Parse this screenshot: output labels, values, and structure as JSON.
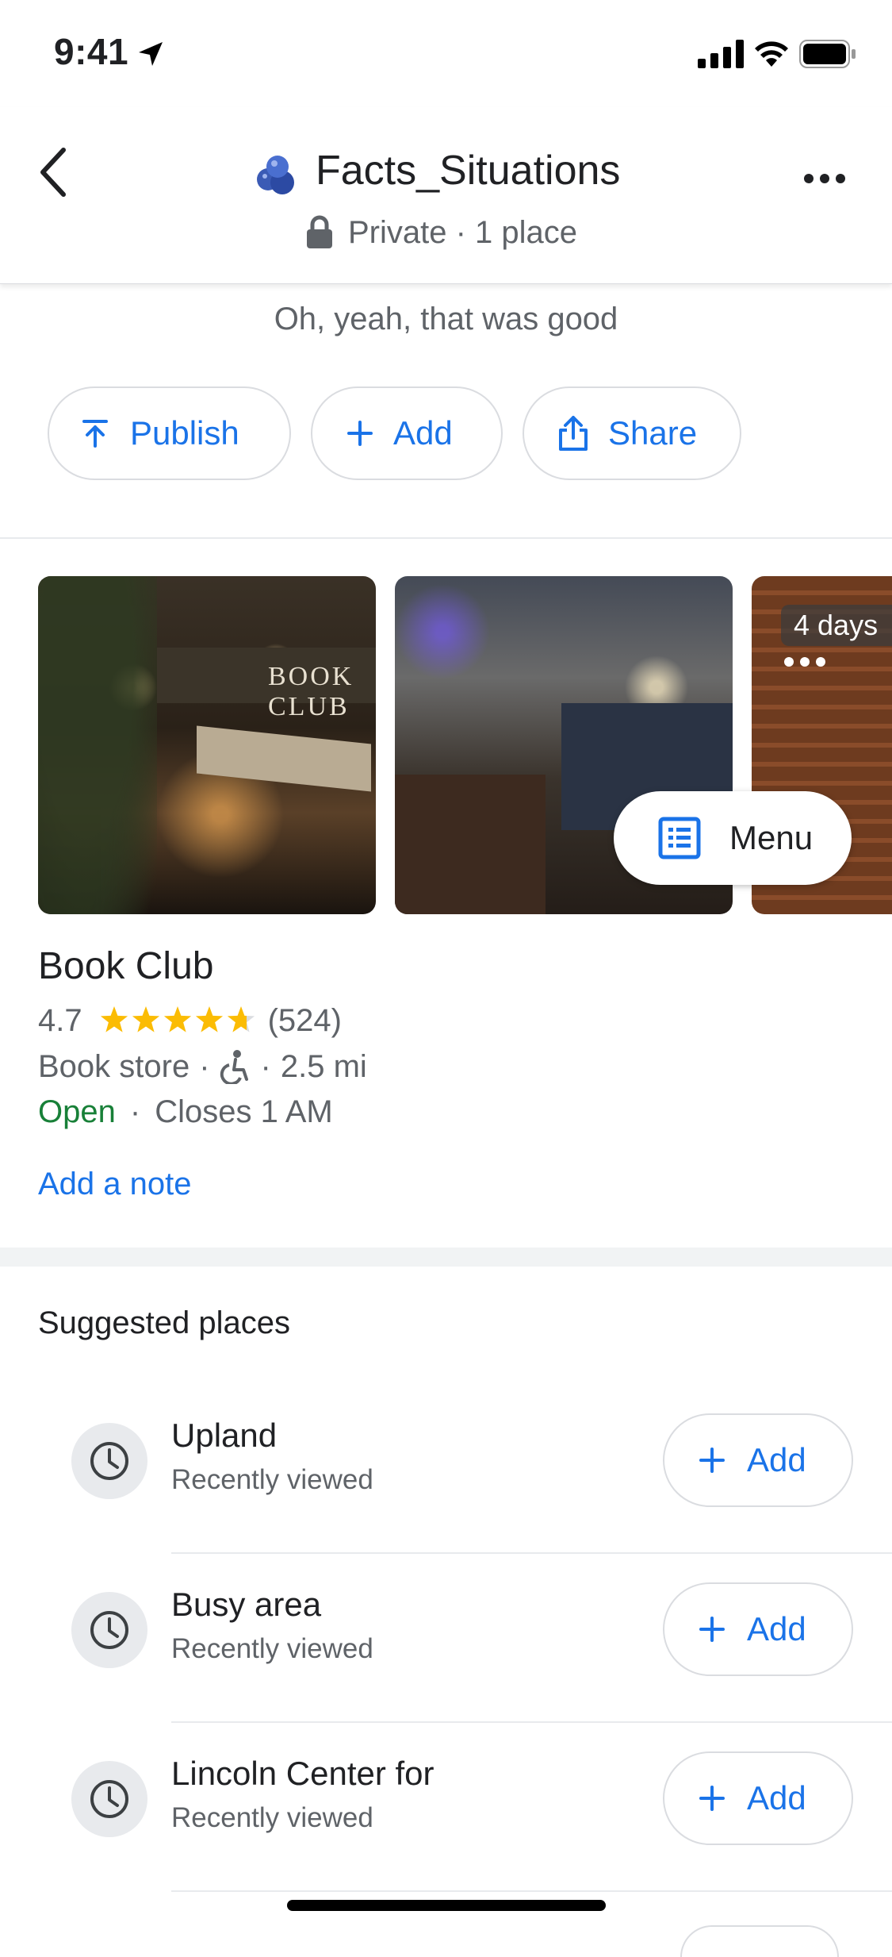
{
  "status_bar": {
    "time": "9:41",
    "icons": [
      "location-arrow-icon",
      "signal-icon",
      "wifi-icon",
      "battery-icon"
    ]
  },
  "header": {
    "title": "Facts_Situations",
    "subtitle": "Private · 1 place",
    "emoji_icon": "blue-berries-emoji-icon",
    "back_icon": "chevron-left-icon",
    "more_icon": "more-horizontal-icon"
  },
  "description": "Oh, yeah, that was good",
  "actions": {
    "publish_label": "Publish",
    "add_label": "Add",
    "share_label": "Share"
  },
  "photos": {
    "awning_text": "BOOK CLUB",
    "badge": "4 days",
    "menu_label": "Menu"
  },
  "place": {
    "name": "Book Club",
    "rating": "4.7",
    "rating_value": 4.7,
    "reviews": "(524)",
    "category": "Book store",
    "distance": "2.5 mi",
    "status": "Open",
    "hours": "Closes 1 AM",
    "add_note": "Add a note"
  },
  "suggested": {
    "title": "Suggested places",
    "items": [
      {
        "name": "Upland",
        "subtitle": "Recently viewed",
        "add_label": "Add"
      },
      {
        "name": "Busy area",
        "subtitle": "Recently viewed",
        "add_label": "Add"
      },
      {
        "name": "Lincoln Center for",
        "subtitle": "Recently viewed",
        "add_label": "Add"
      }
    ]
  },
  "colors": {
    "accent": "#1a73e8",
    "open_green": "#188038",
    "star_gold": "#fbbc04",
    "secondary_text": "#5f6368"
  }
}
